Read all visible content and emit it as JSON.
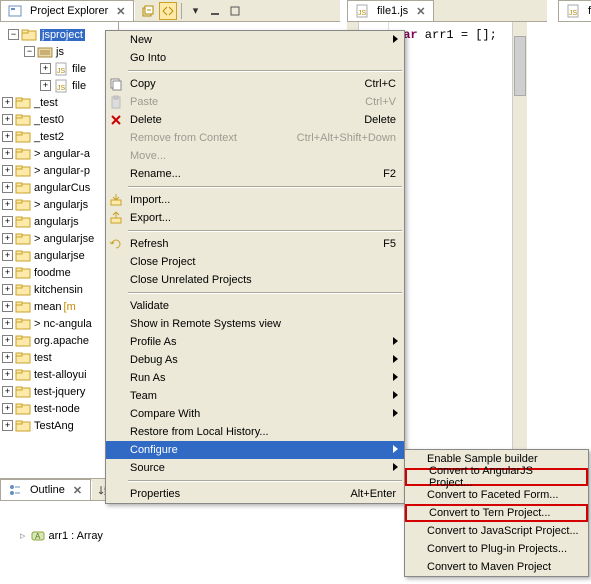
{
  "views": {
    "project_explorer_title": "Project Explorer",
    "outline_title": "Outline"
  },
  "editors": {
    "tab1": "file1.js",
    "tab2": "file",
    "code_keyword": "var",
    "code_rest": " arr1 = [];"
  },
  "tree": {
    "root": "jsproject",
    "src_folder": "js",
    "src_items": [
      "file",
      "file"
    ],
    "projects": [
      "_test",
      "_test0",
      "_test2",
      "> angular-a",
      "> angular-p",
      "angularCus",
      "> angularjs",
      "angularjs",
      "> angularjse",
      "angularjse",
      "foodme",
      "kitchensin",
      "mean",
      "> nc-angula",
      "org.apache",
      "test",
      "test-alloyui",
      "test-jquery",
      "test-node",
      "TestAng"
    ],
    "mean_deco": "[m"
  },
  "outline": {
    "item_label": "arr1 : Array"
  },
  "ctx": {
    "new": "New",
    "go_into": "Go Into",
    "copy": "Copy",
    "copy_accel": "Ctrl+C",
    "paste": "Paste",
    "paste_accel": "Ctrl+V",
    "delete": "Delete",
    "delete_accel": "Delete",
    "remove_ctx": "Remove from Context",
    "remove_ctx_accel": "Ctrl+Alt+Shift+Down",
    "move": "Move...",
    "rename": "Rename...",
    "rename_accel": "F2",
    "import": "Import...",
    "export": "Export...",
    "refresh": "Refresh",
    "refresh_accel": "F5",
    "close_project": "Close Project",
    "close_unrelated": "Close Unrelated Projects",
    "validate": "Validate",
    "show_remote": "Show in Remote Systems view",
    "profile_as": "Profile As",
    "debug_as": "Debug As",
    "run_as": "Run As",
    "team": "Team",
    "compare_with": "Compare With",
    "restore_history": "Restore from Local History...",
    "configure": "Configure",
    "source": "Source",
    "properties": "Properties",
    "properties_accel": "Alt+Enter"
  },
  "submenu": {
    "enable_sample": "Enable Sample builder",
    "angularjs": "Convert to AngularJS Project...",
    "faceted": "Convert to Faceted Form...",
    "tern": "Convert to Tern Project...",
    "javascript": "Convert to JavaScript Project...",
    "plugin": "Convert to Plug-in Projects...",
    "maven": "Convert to Maven Project"
  }
}
